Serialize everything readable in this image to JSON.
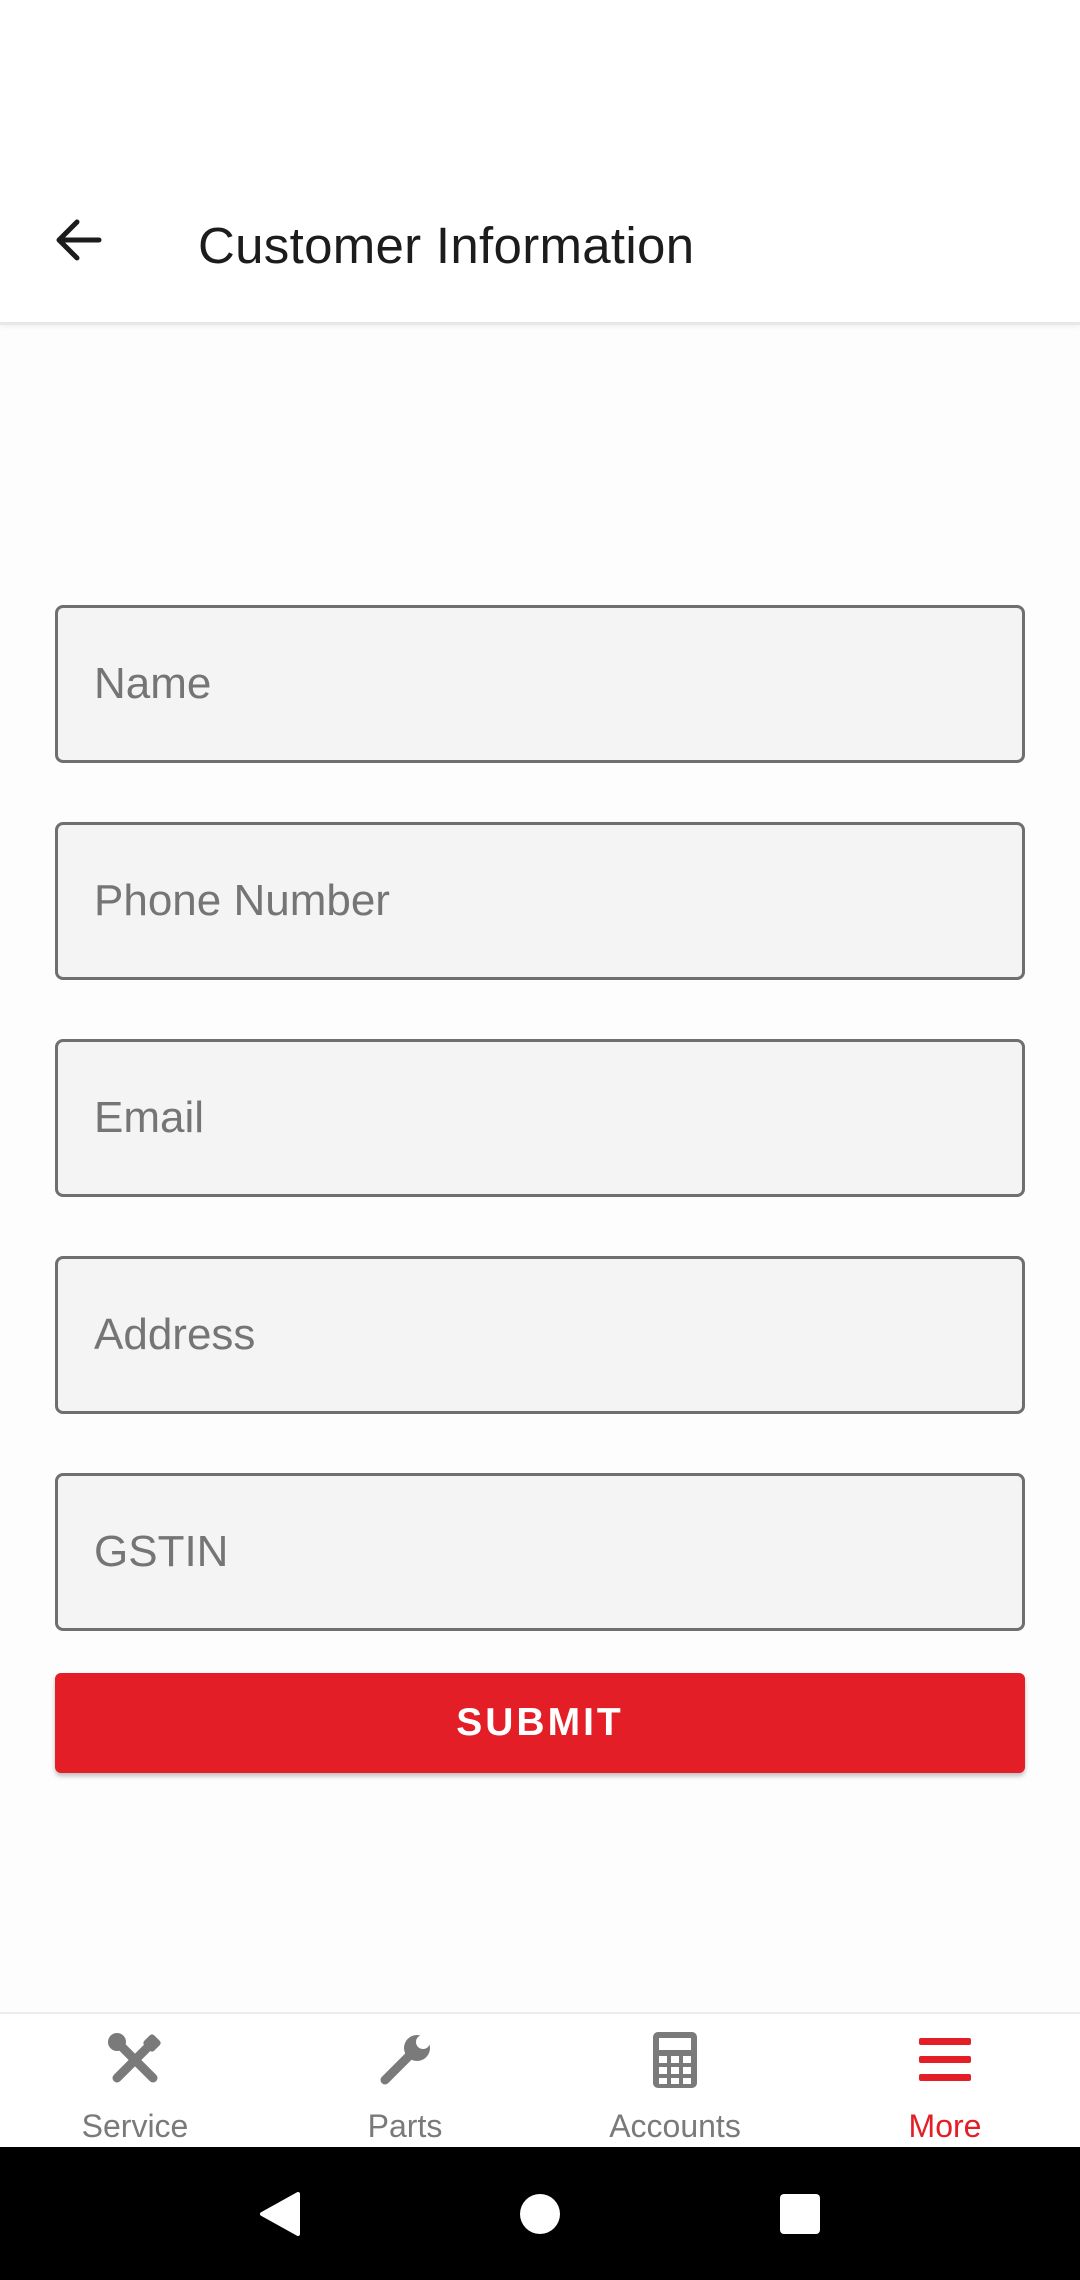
{
  "header": {
    "title": "Customer Information",
    "back_icon": "arrow-back-icon"
  },
  "form": {
    "fields": [
      {
        "placeholder": "Name",
        "value": ""
      },
      {
        "placeholder": "Phone Number",
        "value": ""
      },
      {
        "placeholder": "Email",
        "value": ""
      },
      {
        "placeholder": "Address",
        "value": ""
      },
      {
        "placeholder": "GSTIN",
        "value": ""
      }
    ],
    "submit_label": "SUBMIT"
  },
  "bottom_nav": {
    "items": [
      {
        "label": "Service",
        "icon": "tools-icon",
        "active": false
      },
      {
        "label": "Parts",
        "icon": "wrench-icon",
        "active": false
      },
      {
        "label": "Accounts",
        "icon": "calculator-icon",
        "active": false
      },
      {
        "label": "More",
        "icon": "menu-icon",
        "active": true
      }
    ]
  },
  "colors": {
    "accent": "#e31e26",
    "inactive": "#7a7a7a",
    "field_bg": "#f4f4f4",
    "field_border": "#6f6f6f"
  }
}
